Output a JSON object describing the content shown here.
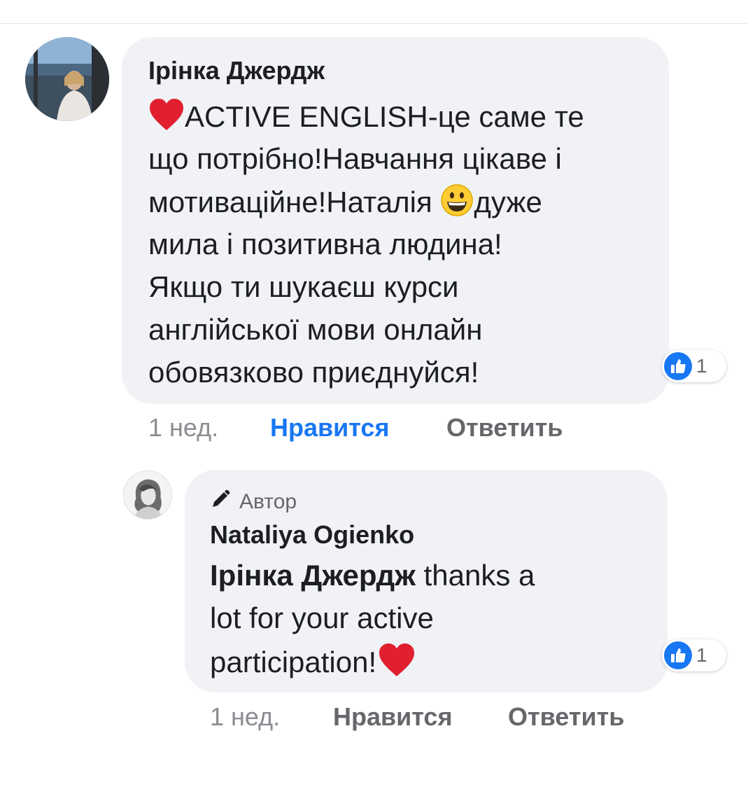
{
  "comment": {
    "author": "Ірінка Джердж",
    "lines": [
      {
        "emoji": "red-heart",
        "text": "ACTIVE  ENGLISH-це саме те"
      },
      {
        "text": "що потрібно!Навчання цікаве і"
      },
      {
        "text_before": "мотиваційне!Наталія ",
        "emoji": "grinning-face",
        "text_after": "дуже"
      },
      {
        "text": "мила і позитивна людина!"
      },
      {
        "text": "Якщо ти шукаєш курси"
      },
      {
        "text": "англійської мови онлайн"
      },
      {
        "text": "обовязково  приєднуйся!"
      }
    ],
    "reaction_count": "1",
    "time": "1 нед.",
    "like_label": "Нравится",
    "reply_label": "Ответить",
    "like_color": "#1877f2"
  },
  "reply": {
    "badge_label": "Автор",
    "author": "Nataliya  Ogienko",
    "mention": "Ірінка Джердж",
    "lines": [
      {
        "text": " thanks a"
      },
      {
        "text": "lot for your active"
      },
      {
        "text": "participation!",
        "emoji": "red-heart"
      }
    ],
    "reaction_count": "1",
    "time": "1 нед.",
    "like_label": "Нравится",
    "reply_label": "Ответить"
  },
  "colors": {
    "bubble_bg": "#f0f2f5",
    "text": "#1c1e21",
    "secondary": "#65676b",
    "accent_blue": "#1877f2",
    "heart": "#e0202f"
  },
  "icons": [
    "red-heart",
    "grinning-face",
    "thumbs-up-icon",
    "pencil-icon"
  ]
}
